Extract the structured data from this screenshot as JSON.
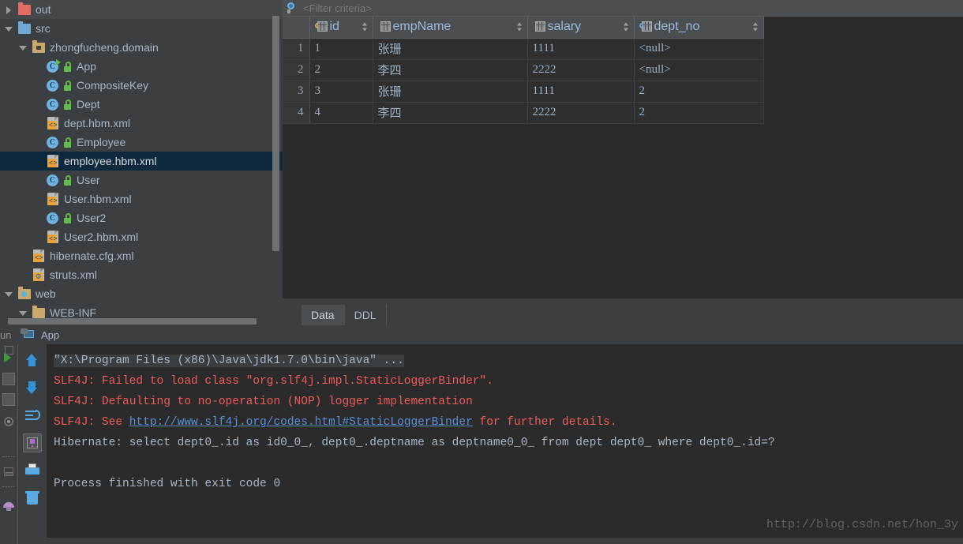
{
  "project_tree": {
    "items": [
      {
        "label": "out",
        "indent": 0,
        "arrow": "right",
        "icon": "folder-red",
        "selected": false,
        "hover": true
      },
      {
        "label": "src",
        "indent": 0,
        "arrow": "down",
        "icon": "folder-blue",
        "selected": false,
        "hover": false
      },
      {
        "label": "zhongfucheng.domain",
        "indent": 1,
        "arrow": "down",
        "icon": "folder-package",
        "selected": false,
        "hover": false
      },
      {
        "label": "App",
        "indent": 2,
        "arrow": "none",
        "icon": "class-runnable",
        "selected": false,
        "hover": false,
        "lock": true
      },
      {
        "label": "CompositeKey",
        "indent": 2,
        "arrow": "none",
        "icon": "class",
        "selected": false,
        "hover": false,
        "lock": true
      },
      {
        "label": "Dept",
        "indent": 2,
        "arrow": "none",
        "icon": "class",
        "selected": false,
        "hover": false,
        "lock": true
      },
      {
        "label": "dept.hbm.xml",
        "indent": 2,
        "arrow": "none",
        "icon": "xml-file",
        "selected": false,
        "hover": false
      },
      {
        "label": "Employee",
        "indent": 2,
        "arrow": "none",
        "icon": "class",
        "selected": false,
        "hover": false,
        "lock": true
      },
      {
        "label": "employee.hbm.xml",
        "indent": 2,
        "arrow": "none",
        "icon": "xml-file",
        "selected": true,
        "hover": false
      },
      {
        "label": "User",
        "indent": 2,
        "arrow": "none",
        "icon": "class",
        "selected": false,
        "hover": false,
        "lock": true
      },
      {
        "label": "User.hbm.xml",
        "indent": 2,
        "arrow": "none",
        "icon": "xml-file",
        "selected": false,
        "hover": false
      },
      {
        "label": "User2",
        "indent": 2,
        "arrow": "none",
        "icon": "class",
        "selected": false,
        "hover": false,
        "lock": true
      },
      {
        "label": "User2.hbm.xml",
        "indent": 2,
        "arrow": "none",
        "icon": "xml-file",
        "selected": false,
        "hover": false
      },
      {
        "label": "hibernate.cfg.xml",
        "indent": 1,
        "arrow": "none",
        "icon": "xml-file",
        "selected": false,
        "hover": false
      },
      {
        "label": "struts.xml",
        "indent": 1,
        "arrow": "none",
        "icon": "xml-struts-file",
        "selected": false,
        "hover": false
      },
      {
        "label": "web",
        "indent": 0,
        "arrow": "down",
        "icon": "folder-web",
        "selected": false,
        "hover": false
      },
      {
        "label": "WEB-INF",
        "indent": 1,
        "arrow": "down",
        "icon": "folder-tan",
        "selected": false,
        "hover": false
      }
    ]
  },
  "data_panel": {
    "filter": {
      "placeholder": "<Filter criteria>",
      "value": "",
      "icon": "search-icon"
    },
    "table": {
      "columns": [
        {
          "name": "id",
          "icon": "primary-key-column-icon",
          "key": "gold"
        },
        {
          "name": "empName",
          "icon": "column-icon",
          "key": "none"
        },
        {
          "name": "salary",
          "icon": "column-icon",
          "key": "none"
        },
        {
          "name": "dept_no",
          "icon": "foreign-key-column-icon",
          "key": "blue"
        }
      ],
      "rows": [
        {
          "num": "1",
          "id": "1",
          "empName": "张珊",
          "salary": "1111",
          "dept_no": "<null>"
        },
        {
          "num": "2",
          "id": "2",
          "empName": "李四",
          "salary": "2222",
          "dept_no": "<null>"
        },
        {
          "num": "3",
          "id": "3",
          "empName": "张珊",
          "salary": "1111",
          "dept_no": "2"
        },
        {
          "num": "4",
          "id": "4",
          "empName": "李四",
          "salary": "2222",
          "dept_no": "2"
        }
      ]
    },
    "tabs": [
      {
        "label": "Data",
        "active": true
      },
      {
        "label": "DDL",
        "active": false
      }
    ]
  },
  "run_bar": {
    "prefix": "un",
    "config_name": "App",
    "icon": "run-configuration-icon"
  },
  "console": {
    "toolbar": [
      {
        "name": "up-arrow-icon",
        "active": false
      },
      {
        "name": "down-arrow-icon",
        "active": false
      },
      {
        "name": "soft-wrap-icon",
        "active": false
      },
      {
        "name": "scroll-to-end-icon",
        "active": true
      },
      {
        "name": "print-icon",
        "active": false
      },
      {
        "name": "trash-icon",
        "active": false
      }
    ],
    "lines": [
      {
        "type": "cmd",
        "text": "\"X:\\Program Files (x86)\\Java\\jdk1.7.0\\bin\\java\" ..."
      },
      {
        "type": "err",
        "text": "SLF4J: Failed to load class \"org.slf4j.impl.StaticLoggerBinder\"."
      },
      {
        "type": "err",
        "text": "SLF4J: Defaulting to no-operation (NOP) logger implementation"
      },
      {
        "type": "err-link",
        "prefix": "SLF4J: See ",
        "link": "http://www.slf4j.org/codes.html#StaticLoggerBinder",
        "suffix": " for further details."
      },
      {
        "type": "info",
        "text": "Hibernate: select dept0_.id as id0_0_, dept0_.deptname as deptname0_0_ from dept dept0_ where dept0_.id=?"
      },
      {
        "type": "blank",
        "text": ""
      },
      {
        "type": "info",
        "text": "Process finished with exit code 0"
      }
    ]
  },
  "watermark": {
    "text": "http://blog.csdn.net/hon_3y"
  },
  "colors": {
    "panel_bg": "#3c3f41",
    "editor_bg": "#2b2b2b",
    "selection": "#0d293e",
    "header_bg": "#4b4f51",
    "text": "#a9b7c6",
    "error": "#f05a5a",
    "link": "#5a8fd6"
  }
}
